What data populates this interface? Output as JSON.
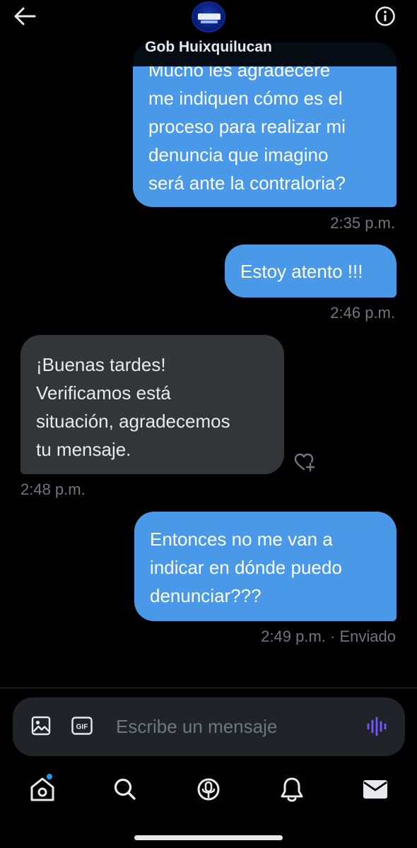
{
  "header": {
    "title": "Gob Huixquilucan",
    "back_icon": "arrow-left-icon",
    "info_icon": "info-circle-icon"
  },
  "messages": [
    {
      "direction": "sent",
      "lines": [
        "Mucho les agradecere",
        "me indiquen cómo es el",
        "proceso para realizar mi",
        "denuncia que imagino",
        "será ante la contraloria?"
      ],
      "time": "2:35 p.m."
    },
    {
      "direction": "sent",
      "lines": [
        "Estoy atento !!!"
      ],
      "time": "2:46 p.m."
    },
    {
      "direction": "received",
      "lines": [
        "¡Buenas tardes!",
        "Verificamos está",
        "situación, agradecemos",
        "tu mensaje."
      ],
      "time": "2:48 p.m."
    },
    {
      "direction": "sent",
      "lines": [
        "Entonces no me van a",
        "indicar en dónde puedo",
        "denunciar???"
      ],
      "time": "2:49 p.m.",
      "status": "· Enviado"
    }
  ],
  "composer": {
    "placeholder": "Escribe un mensaje",
    "gif_label": "GIF"
  },
  "nav": {
    "items": [
      "home-icon",
      "search-icon",
      "spaces-icon",
      "notifications-icon",
      "messages-icon"
    ],
    "home_has_badge": true
  },
  "colors": {
    "sent_bubble": "#4a99e9",
    "received_bubble": "#333638",
    "accent": "#1d9bf0",
    "voice_accent": "#7856ff"
  }
}
